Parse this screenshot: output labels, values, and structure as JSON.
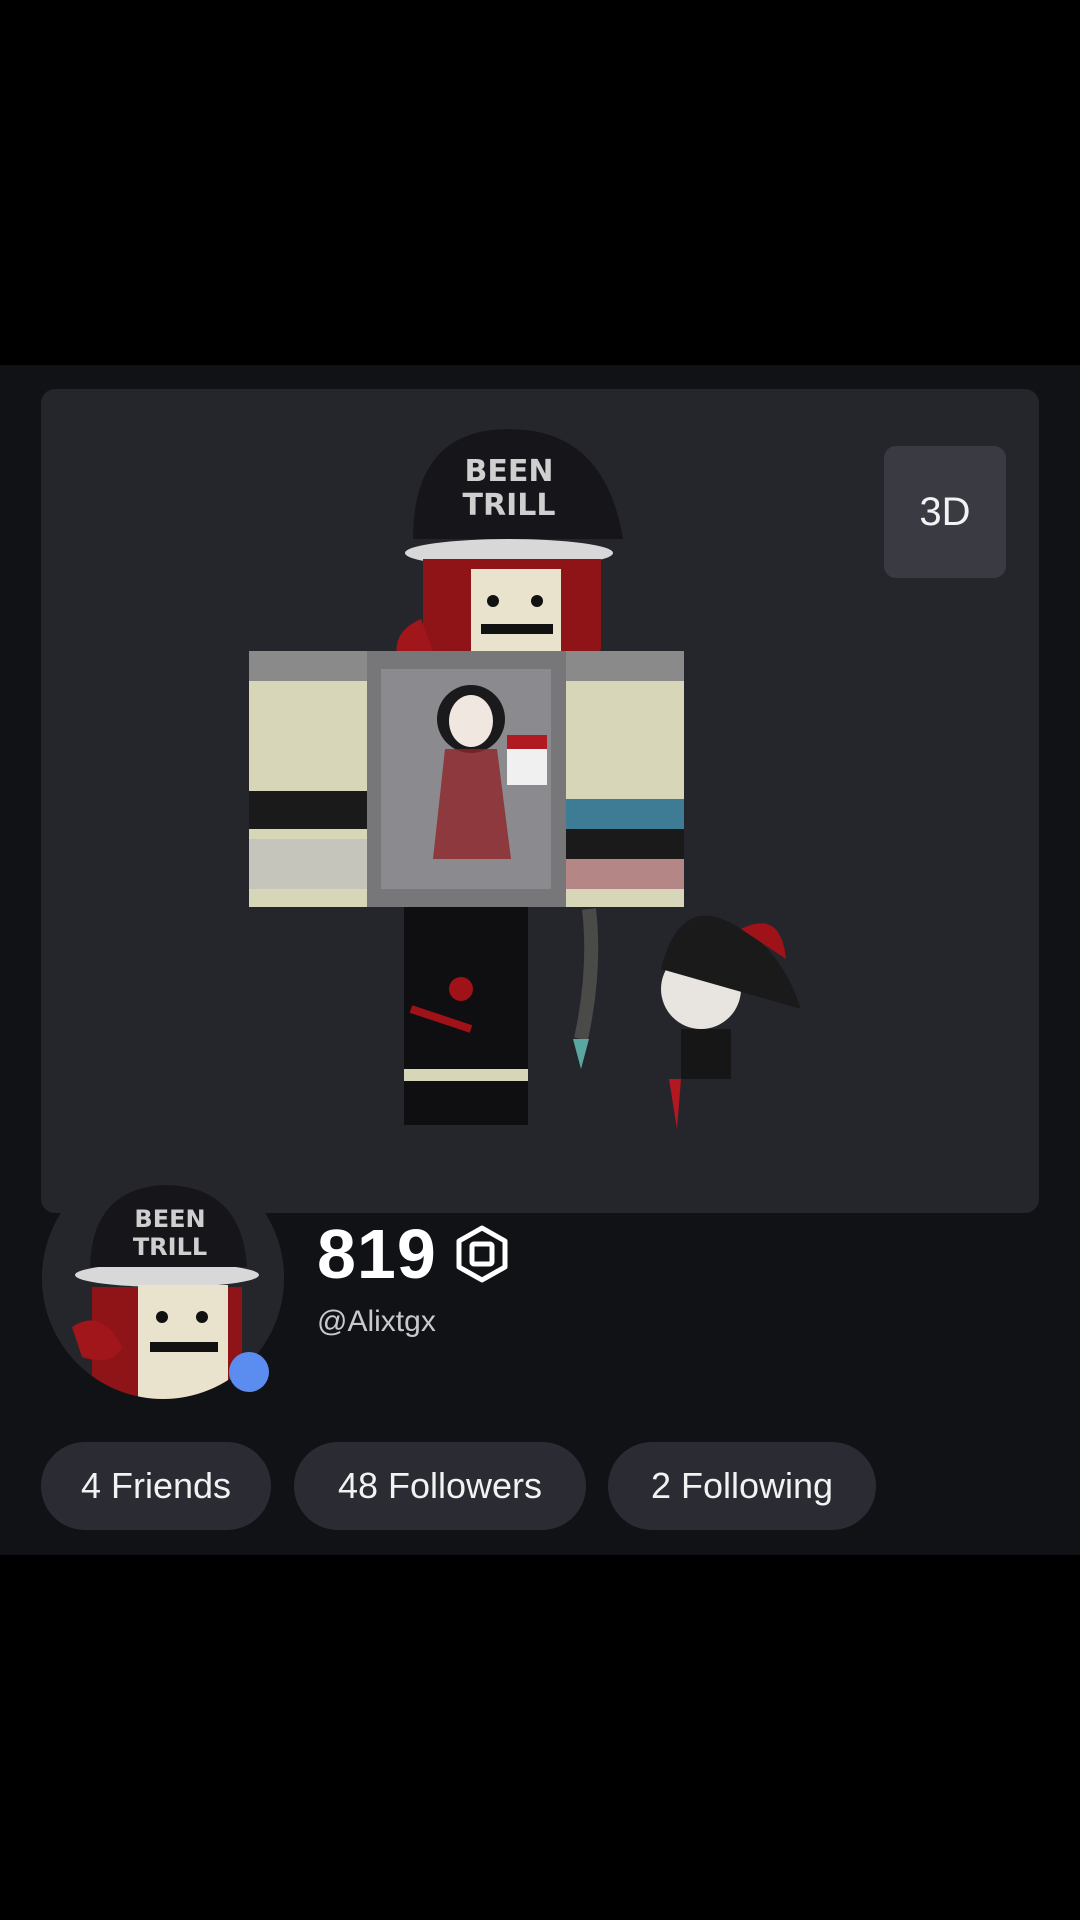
{
  "profile": {
    "view_toggle_label": "3D",
    "robux_balance": "819",
    "username": "@Alixtgx",
    "presence_color": "#5b8cf0",
    "avatar_hat_text_line1": "BEEN",
    "avatar_hat_text_line2": "TRILL"
  },
  "social": {
    "friends_label": "4 Friends",
    "followers_label": "48 Followers",
    "following_label": "2 Following"
  },
  "icons": {
    "robux": "robux-icon",
    "presence": "online-status-icon"
  }
}
